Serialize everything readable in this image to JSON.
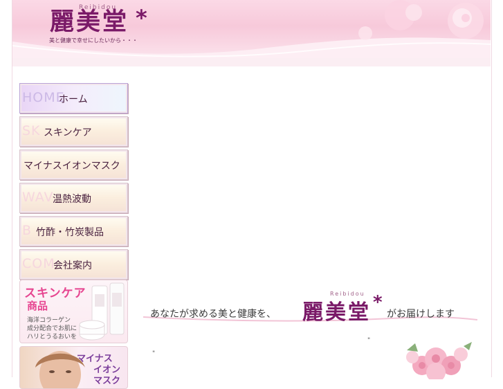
{
  "brand": {
    "name": "麗美堂",
    "star": "*",
    "roman": "Reibidou",
    "tagline": "美と健康で幸せにしたいから・・・"
  },
  "nav": {
    "items": [
      {
        "bg": "HOME",
        "label": "ホーム"
      },
      {
        "bg": "SK",
        "label": "スキンケア"
      },
      {
        "bg": "",
        "label": "マイナスイオンマスク"
      },
      {
        "bg": "WAV",
        "label": "温熱波動"
      },
      {
        "bg": "B",
        "label": "竹酢・竹炭製品"
      },
      {
        "bg": "COM",
        "label": "会社案内"
      }
    ]
  },
  "promo_skincare": {
    "title1": "スキンケア",
    "title2": "商品",
    "lines": [
      "海洋コラーゲン",
      "成分配合でお肌に",
      "ハリとうるおいを"
    ]
  },
  "promo_mask": {
    "lines": [
      "マイナス",
      "イオン",
      "マスク"
    ]
  },
  "banner": {
    "prefix": "あなたが求める美と健康を、",
    "brand": "麗美堂",
    "star": "*",
    "roman": "Reibidou",
    "suffix": "がお届けします"
  },
  "quotes": {
    "open": "\"",
    "close": "\""
  },
  "colors": {
    "brand": "#7a1a68",
    "accent_pink": "#e64590",
    "header_pink": "#f7c9da"
  }
}
